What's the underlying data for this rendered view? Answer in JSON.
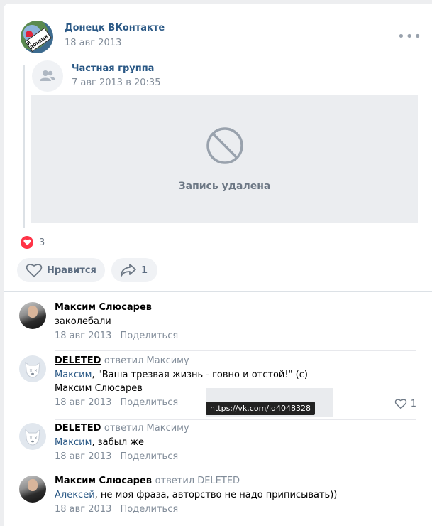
{
  "post": {
    "author": "Донецк ВКонтакте",
    "date": "18 авг 2013",
    "avatar_text": "Я ДОНЕЦК",
    "more_label": "•••",
    "repost": {
      "author": "Частная группа",
      "date": "7 авг 2013 в 20:35",
      "deleted_text": "Запись удалена"
    },
    "likes_count": "3",
    "like_button_label": "Нравится",
    "share_count": "1"
  },
  "comments": [
    {
      "author": "Максим Слюсарев",
      "replied": "",
      "addressee": "",
      "text": "заколебали",
      "date": "18 авг 2013",
      "share_label": "Поделиться"
    },
    {
      "author": "DELETED",
      "replied": "ответил Максиму",
      "addressee": "Максим",
      "text": ", \"Ваша трезвая жизнь - говно и отстой!\" (с) Максим Слюсарев",
      "date": "18 авг 2013",
      "share_label": "Поделиться",
      "likes": "1",
      "tooltip": "https://vk.com/id4048328"
    },
    {
      "author": "DELETED",
      "replied": "ответил Максиму",
      "addressee": "Максим",
      "text": ", забыл же",
      "date": "18 авг 2013",
      "share_label": "Поделиться"
    },
    {
      "author": "Максим Слюсарев",
      "replied": "ответил DELETED",
      "addressee": "Алексей",
      "text": ", не моя фраза, авторство не надо приписывать))",
      "date": "18 авг 2013",
      "share_label": "Поделиться"
    }
  ],
  "colors": {
    "link": "#2a5885",
    "meta": "#818c99",
    "like_red": "#ff3347",
    "button_bg": "#f0f2f5"
  }
}
